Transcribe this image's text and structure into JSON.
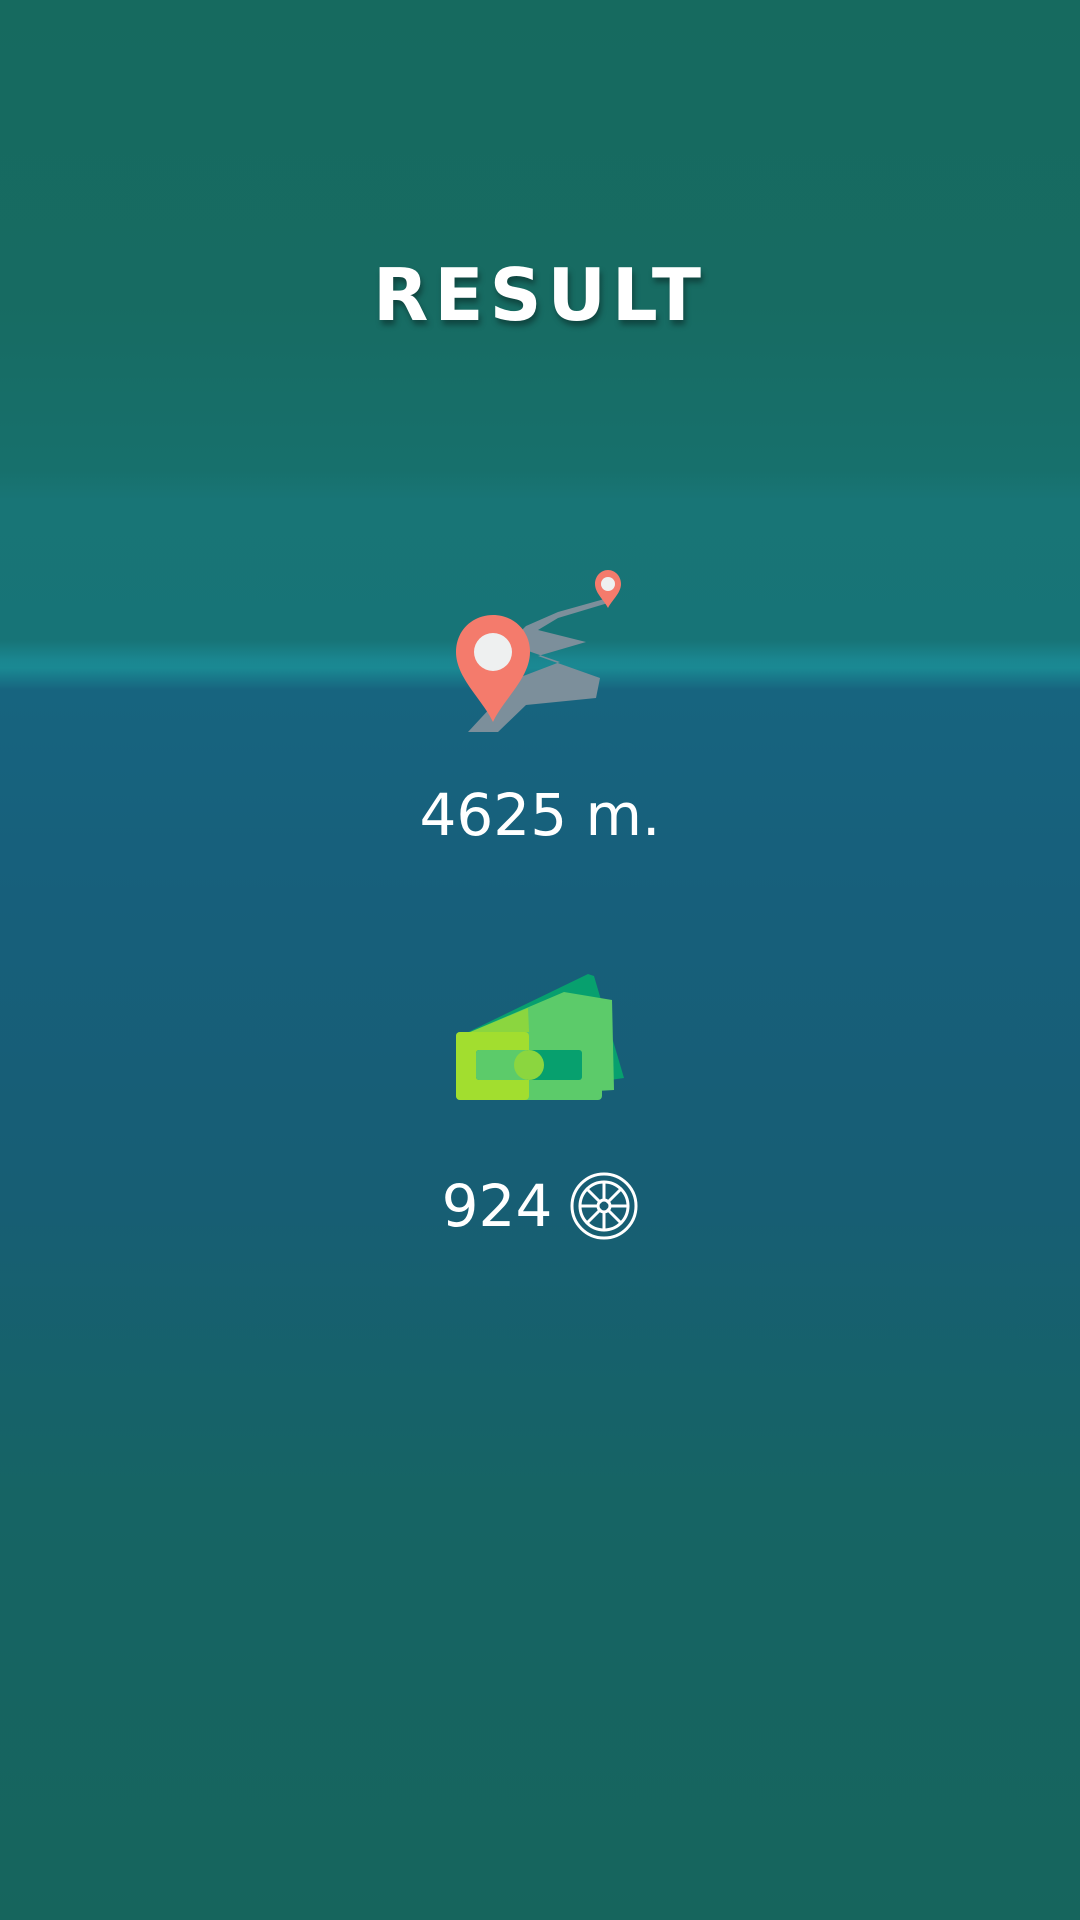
{
  "header": {
    "title": "RESULT"
  },
  "stats": {
    "distance_text": "4625 m.",
    "coins_text": "924"
  },
  "icons": {
    "route": "route-map-pin-icon",
    "money": "money-bills-icon",
    "coin": "wheel-coin-icon"
  },
  "colors": {
    "pin": "#f47b6c",
    "road": "#7c8f9b",
    "bill_light": "#a2de2f",
    "bill_mid": "#5ccb6a",
    "bill_dark": "#07a06e",
    "text": "#ffffff"
  }
}
